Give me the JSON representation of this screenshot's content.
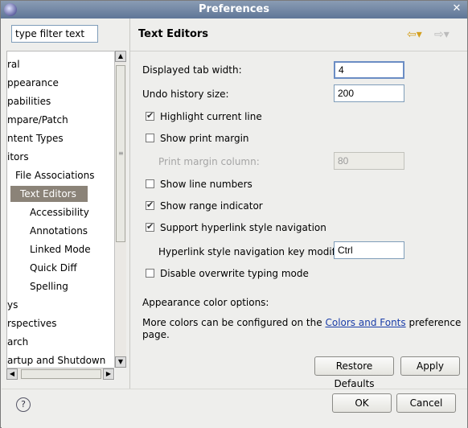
{
  "window": {
    "title": "Preferences",
    "close_glyph": "✕"
  },
  "filter": {
    "placeholder": "type filter text",
    "value": "type filter text"
  },
  "tree": {
    "items": [
      "ral",
      "ppearance",
      "pabilities",
      "mpare/Patch",
      "ntent Types",
      "itors",
      "File Associations",
      "Text Editors",
      "Accessibility",
      "Annotations",
      "Linked Mode",
      "Quick Diff",
      "Spelling",
      "ys",
      "rspectives",
      "arch",
      "artup and Shutdown"
    ],
    "selected_index": 7
  },
  "page": {
    "title": "Text Editors",
    "back_icon": "back-arrow-icon",
    "forward_icon": "forward-arrow-icon",
    "tab_width_label": "Displayed tab width:",
    "tab_width_value": "4",
    "undo_label": "Undo history size:",
    "undo_value": "200",
    "highlight_line_label": "Highlight current line",
    "print_margin_label": "Show print margin",
    "print_margin_col_label": "Print margin column:",
    "print_margin_col_value": "80",
    "line_numbers_label": "Show line numbers",
    "range_indicator_label": "Show range indicator",
    "hyperlink_label": "Support hyperlink style navigation",
    "hyperlink_key_label": "Hyperlink style navigation key modifier:",
    "hyperlink_key_value": "Ctrl",
    "overwrite_label": "Disable overwrite typing mode",
    "appearance_label": "Appearance color options:",
    "more_colors_prefix": "More colors can be configured on the",
    "colors_link": "Colors and Fonts",
    "more_colors_suffix": "preference",
    "more_colors_line2": "page.",
    "restore_defaults": "Restore Defaults",
    "apply": "Apply"
  },
  "checkboxes": {
    "highlight_line": true,
    "print_margin": false,
    "line_numbers": false,
    "range_indicator": true,
    "hyperlink": true,
    "overwrite": false
  },
  "footer": {
    "ok": "OK",
    "cancel": "Cancel",
    "help_icon": "help-icon"
  }
}
